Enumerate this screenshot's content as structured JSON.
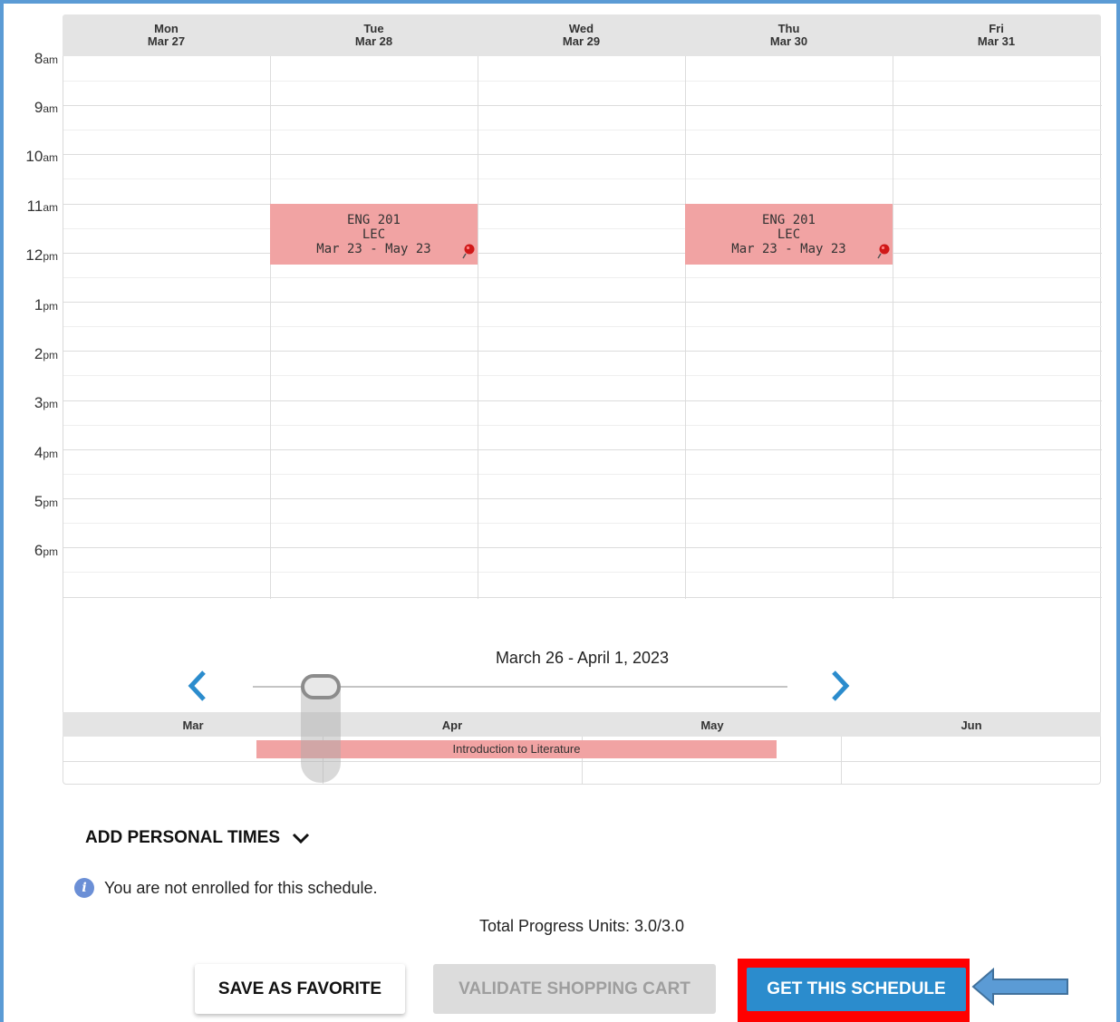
{
  "days": [
    {
      "dow": "Mon",
      "date": "Mar 27"
    },
    {
      "dow": "Tue",
      "date": "Mar 28"
    },
    {
      "dow": "Wed",
      "date": "Mar 29"
    },
    {
      "dow": "Thu",
      "date": "Mar 30"
    },
    {
      "dow": "Fri",
      "date": "Mar 31"
    }
  ],
  "times": [
    {
      "hour": "8",
      "ampm": "am"
    },
    {
      "hour": "9",
      "ampm": "am"
    },
    {
      "hour": "10",
      "ampm": "am"
    },
    {
      "hour": "11",
      "ampm": "am"
    },
    {
      "hour": "12",
      "ampm": "pm"
    },
    {
      "hour": "1",
      "ampm": "pm"
    },
    {
      "hour": "2",
      "ampm": "pm"
    },
    {
      "hour": "3",
      "ampm": "pm"
    },
    {
      "hour": "4",
      "ampm": "pm"
    },
    {
      "hour": "5",
      "ampm": "pm"
    },
    {
      "hour": "6",
      "ampm": "pm"
    }
  ],
  "events": [
    {
      "course": "ENG 201",
      "type": "LEC",
      "dates": "Mar 23 - May 23"
    },
    {
      "course": "ENG 201",
      "type": "LEC",
      "dates": "Mar 23 - May 23"
    }
  ],
  "timeline": {
    "range_label": "March 26 - April 1, 2023",
    "months": [
      "Mar",
      "Apr",
      "May",
      "Jun"
    ],
    "course_bar": "Introduction to Literature"
  },
  "personal_times": {
    "label": "ADD PERSONAL TIMES"
  },
  "info": {
    "message": "You are not enrolled for this schedule.",
    "icon_glyph": "i"
  },
  "units": {
    "text": "Total Progress Units: 3.0/3.0"
  },
  "buttons": {
    "save_favorite": "SAVE AS FAVORITE",
    "validate_cart": "VALIDATE SHOPPING CART",
    "get_schedule": "GET THIS SCHEDULE"
  },
  "colors": {
    "event_fill": "#f1a3a3",
    "primary_button": "#2b8ccd",
    "highlight_outline": "#ff0000",
    "nav_arrow": "#2b8ccd",
    "annotation_arrow": "#5b9bd5",
    "frame_border": "#5b9bd5"
  }
}
